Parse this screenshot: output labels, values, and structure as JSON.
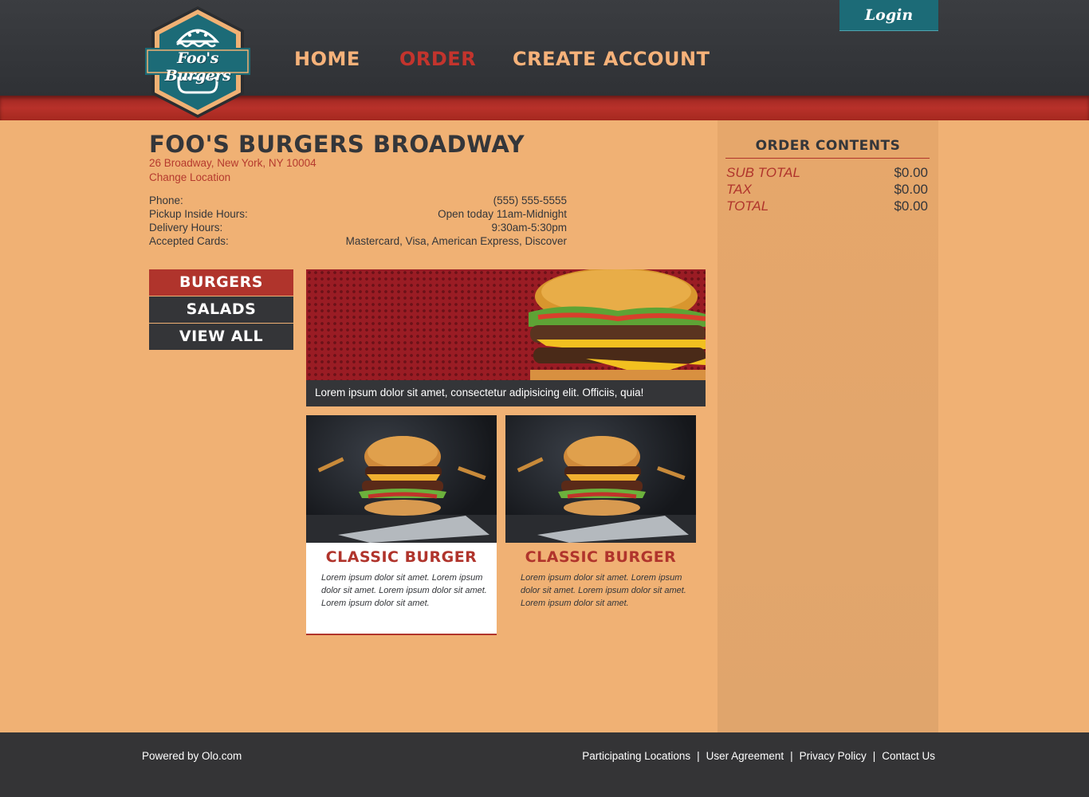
{
  "brand": {
    "logo_text": "Foo's Burgers"
  },
  "nav": {
    "items": [
      {
        "label": "Home",
        "active": false
      },
      {
        "label": "Order",
        "active": true
      },
      {
        "label": "Create Account",
        "active": false
      }
    ],
    "login_label": "Login"
  },
  "store": {
    "name": "Foo's Burgers Broadway",
    "address": "26 Broadway, New York, NY 10004",
    "change_location": "Change Location",
    "info": [
      {
        "label": "Phone:",
        "value": "(555) 555-5555"
      },
      {
        "label": "Pickup Inside Hours:",
        "value": "Open today 11am-Midnight"
      },
      {
        "label": "Delivery Hours:",
        "value": "9:30am-5:30pm"
      },
      {
        "label": "Accepted Cards:",
        "value": "Mastercard, Visa, American Express, Discover"
      }
    ]
  },
  "categories": [
    {
      "label": "Burgers",
      "active": true
    },
    {
      "label": "Salads",
      "active": false
    },
    {
      "label": "View All",
      "active": false
    }
  ],
  "hero": {
    "caption": "Lorem ipsum dolor sit amet, consectetur adipisicing elit. Officiis, quia!"
  },
  "products": [
    {
      "title": "Classic Burger",
      "description": "Lorem ipsum dolor sit amet. Lorem ipsum dolor sit amet. Lorem ipsum dolor sit amet. Lorem ipsum dolor sit amet."
    },
    {
      "title": "Classic Burger",
      "description": "Lorem ipsum dolor sit amet. Lorem ipsum dolor sit amet. Lorem ipsum dolor sit amet. Lorem ipsum dolor sit amet."
    }
  ],
  "order": {
    "title": "Order Contents",
    "rows": [
      {
        "label": "Sub Total",
        "value": "$0.00"
      },
      {
        "label": "Tax",
        "value": "$0.00"
      },
      {
        "label": "Total",
        "value": "$0.00"
      }
    ]
  },
  "footer": {
    "powered_by": "Powered by Olo.com",
    "links": [
      "Participating Locations",
      "User Agreement",
      "Privacy Policy",
      "Contact Us"
    ],
    "separator": "|"
  },
  "colors": {
    "page_bg": "#f0b174",
    "header_bg": "#35373b",
    "accent_red": "#b0342c",
    "teal": "#1c6b77",
    "dark": "#343538"
  },
  "icons": [
    "burger-logo-icon"
  ]
}
